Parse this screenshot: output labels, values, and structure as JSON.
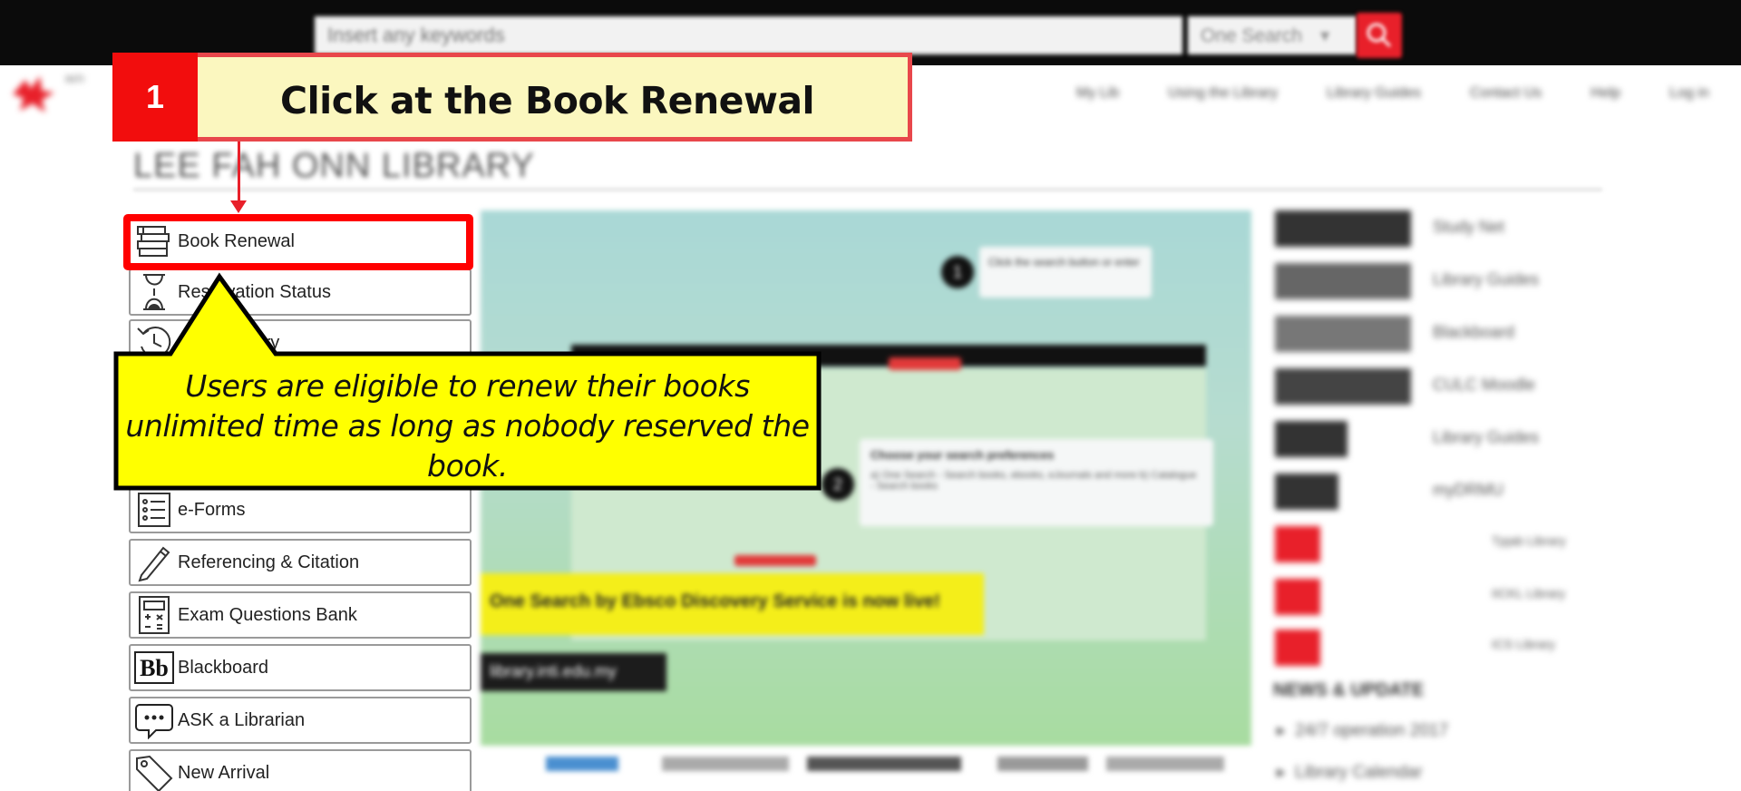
{
  "topbar": {
    "search_placeholder": "Insert any keywords",
    "search_scope": "One Search"
  },
  "nav": {
    "logo_text": "INTI",
    "links": [
      "My Lib",
      "Using the Library",
      "Library Guides",
      "Contact Us",
      "Help",
      "Log in"
    ]
  },
  "page_title": "LEE FAH ONN LIBRARY",
  "menu": {
    "items": [
      {
        "label": "Book Renewal",
        "icon": "books-icon"
      },
      {
        "label": "Reservation Status",
        "icon": "hourglass-icon"
      },
      {
        "label": "Loan History",
        "icon": "history-icon"
      },
      {
        "label": "e-Forms",
        "icon": "list-icon"
      },
      {
        "label": "Referencing & Citation",
        "icon": "pencil-icon"
      },
      {
        "label": "Exam Questions Bank",
        "icon": "calculator-icon"
      },
      {
        "label": "Blackboard",
        "icon": "blackboard-icon"
      },
      {
        "label": "ASK a Librarian",
        "icon": "chat-icon"
      },
      {
        "label": "New Arrival",
        "icon": "tag-icon"
      }
    ]
  },
  "banner": {
    "step1_text": "Click the search button or enter",
    "step2_title": "Choose your search preferences",
    "step2_text": "a) One Search - Search books, ebooks, eJournals and more  b) Catalogue - Search books",
    "announcement": "One Search by Ebsco Discovery Service is now live!",
    "url": "library.inti.edu.my"
  },
  "sidebar": {
    "links": [
      "Study Net",
      "Library Guides",
      "Blackboard",
      "CULC Moodle",
      "Library Guides",
      "myDRMU",
      "Tpjab Library",
      "IICKL Library",
      "ICS Library"
    ],
    "news_heading": "NEWS & UPDATE",
    "news_items": [
      "24/7 operation 2017",
      "Library Calendar"
    ]
  },
  "tutorial": {
    "step_number": "1",
    "step_instruction": "Click at the Book Renewal",
    "callout_text": "Users are eligible to renew their books unlimited time as long as nobody reserved the book.",
    "accent_color": "#f20d0d",
    "callout_color": "#ffff00"
  }
}
